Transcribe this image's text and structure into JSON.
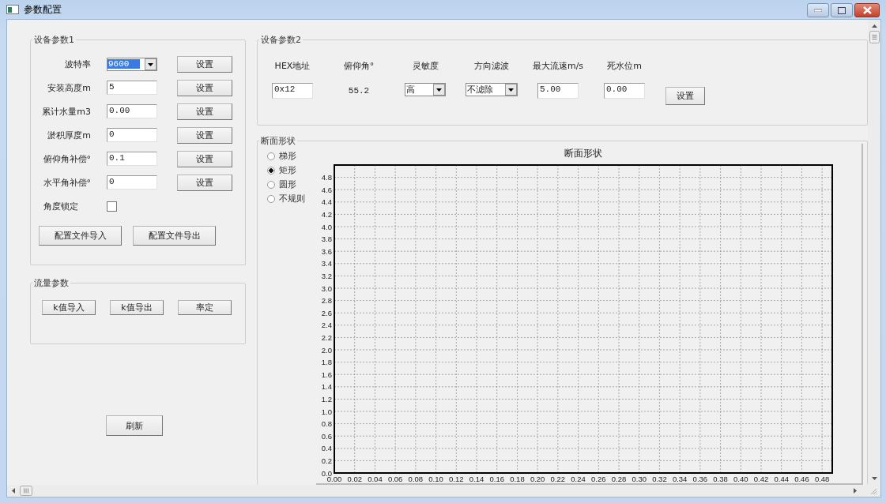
{
  "window": {
    "title": "参数配置"
  },
  "device_params_1": {
    "title": "设备参数1",
    "rows": [
      {
        "kind": "dropdown",
        "label": "波特率",
        "value": "9600",
        "focused": true,
        "button": "设置"
      },
      {
        "kind": "input",
        "label": "安装高度m",
        "value": "5",
        "focused": false,
        "button": "设置"
      },
      {
        "kind": "input",
        "label": "累计水量m3",
        "value": "0.00",
        "focused": false,
        "button": "设置"
      },
      {
        "kind": "input",
        "label": "淤积厚度m",
        "value": "0",
        "focused": false,
        "button": "设置"
      },
      {
        "kind": "input",
        "label": "俯仰角补偿°",
        "value": "0.1",
        "focused": false,
        "button": "设置"
      },
      {
        "kind": "input",
        "label": "水平角补偿°",
        "value": "0",
        "focused": false,
        "button": "设置"
      }
    ],
    "angle_lock": {
      "label": "角度锁定",
      "checked": false
    },
    "buttons": [
      "配置文件导入",
      "配置文件导出"
    ]
  },
  "flow_params": {
    "title": "流量参数",
    "buttons": [
      "k值导入",
      "k值导出",
      "率定"
    ]
  },
  "refresh_button": "刷新",
  "device_params_2": {
    "title": "设备参数2",
    "columns": [
      {
        "kind": "input",
        "label": "HEX地址",
        "value": "0x12"
      },
      {
        "kind": "readout",
        "label": "俯仰角°",
        "value": "55.2"
      },
      {
        "kind": "dropdown",
        "label": "灵敏度",
        "value": "高"
      },
      {
        "kind": "dropdown",
        "label": "方向滤波",
        "value": "不滤除"
      },
      {
        "kind": "input",
        "label": "最大流速m/s",
        "value": "5.00"
      },
      {
        "kind": "input",
        "label": "死水位m",
        "value": "0.00"
      }
    ],
    "button": "设置"
  },
  "section_shape": {
    "title": "断面形状",
    "options": [
      {
        "label": "梯形",
        "selected": false
      },
      {
        "label": "矩形",
        "selected": true
      },
      {
        "label": "圆形",
        "selected": false
      },
      {
        "label": "不规则",
        "selected": false
      }
    ],
    "chart_data": {
      "type": "line",
      "title": "断面形状",
      "grid": true,
      "xlim": [
        0,
        0.49
      ],
      "ylim": [
        0,
        5
      ],
      "xticks": [
        {
          "value": 0,
          "label": "0.00"
        },
        {
          "value": 0.02,
          "label": "0.02"
        },
        {
          "value": 0.04,
          "label": "0.04"
        },
        {
          "value": 0.06,
          "label": "0.06"
        },
        {
          "value": 0.08,
          "label": "0.08"
        },
        {
          "value": 0.1,
          "label": "0.10"
        },
        {
          "value": 0.12,
          "label": "0.12"
        },
        {
          "value": 0.14,
          "label": "0.14"
        },
        {
          "value": 0.16,
          "label": "0.16"
        },
        {
          "value": 0.18,
          "label": "0.18"
        },
        {
          "value": 0.2,
          "label": "0.20"
        },
        {
          "value": 0.22,
          "label": "0.22"
        },
        {
          "value": 0.24,
          "label": "0.24"
        },
        {
          "value": 0.26,
          "label": "0.26"
        },
        {
          "value": 0.28,
          "label": "0.28"
        },
        {
          "value": 0.3,
          "label": "0.30"
        },
        {
          "value": 0.32,
          "label": "0.32"
        },
        {
          "value": 0.34,
          "label": "0.34"
        },
        {
          "value": 0.36,
          "label": "0.36"
        },
        {
          "value": 0.38,
          "label": "0.38"
        },
        {
          "value": 0.4,
          "label": "0.40"
        },
        {
          "value": 0.42,
          "label": "0.42"
        },
        {
          "value": 0.44,
          "label": "0.44"
        },
        {
          "value": 0.46,
          "label": "0.46"
        },
        {
          "value": 0.48,
          "label": "0.48"
        }
      ],
      "yticks": [
        {
          "value": 0,
          "label": "0.0"
        },
        {
          "value": 0.2,
          "label": "0.2"
        },
        {
          "value": 0.4,
          "label": "0.4"
        },
        {
          "value": 0.6,
          "label": "0.6"
        },
        {
          "value": 0.8,
          "label": "0.8"
        },
        {
          "value": 1,
          "label": "1.0"
        },
        {
          "value": 1.2,
          "label": "1.2"
        },
        {
          "value": 1.4,
          "label": "1.4"
        },
        {
          "value": 1.6,
          "label": "1.6"
        },
        {
          "value": 1.8,
          "label": "1.8"
        },
        {
          "value": 2,
          "label": "2.0"
        },
        {
          "value": 2.2,
          "label": "2.2"
        },
        {
          "value": 2.4,
          "label": "2.4"
        },
        {
          "value": 2.6,
          "label": "2.6"
        },
        {
          "value": 2.8,
          "label": "2.8"
        },
        {
          "value": 3,
          "label": "3.0"
        },
        {
          "value": 3.2,
          "label": "3.2"
        },
        {
          "value": 3.4,
          "label": "3.4"
        },
        {
          "value": 3.6,
          "label": "3.6"
        },
        {
          "value": 3.8,
          "label": "3.8"
        },
        {
          "value": 4,
          "label": "4.0"
        },
        {
          "value": 4.2,
          "label": "4.2"
        },
        {
          "value": 4.4,
          "label": "4.4"
        },
        {
          "value": 4.6,
          "label": "4.6"
        },
        {
          "value": 4.8,
          "label": "4.8"
        }
      ]
    }
  }
}
